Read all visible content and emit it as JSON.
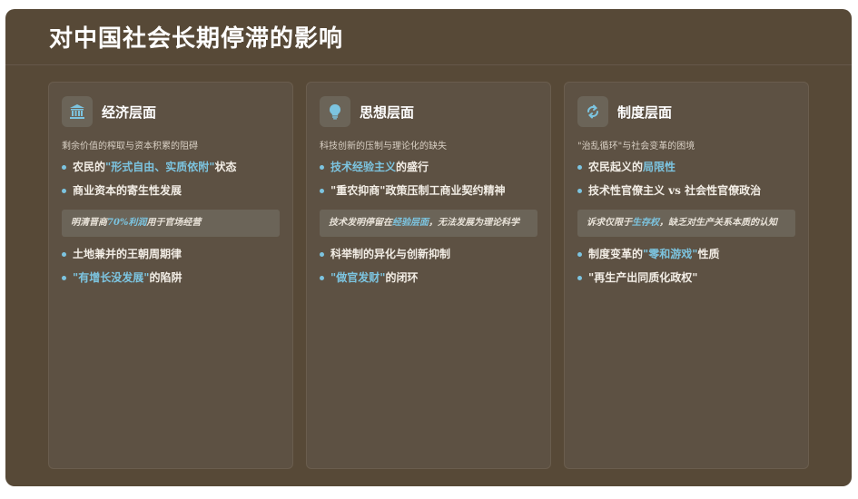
{
  "title": "对中国社会长期停滞的影响",
  "cards": [
    {
      "icon": "bank-icon",
      "title": "经济层面",
      "subtitle": "剩余价值的榨取与资本积累的阻碍",
      "b1": {
        "pre": "农民的",
        "hl": "\"形式自由、实质依附\"",
        "post": "状态"
      },
      "b2": {
        "pre": "商业资本的寄生性发展",
        "hl": "",
        "post": ""
      },
      "callout": {
        "pre": "明清晋商",
        "hl": "70%利润",
        "post": "用于官场经营"
      },
      "b3": {
        "pre": "土地兼并的王朝周期律",
        "hl": "",
        "post": ""
      },
      "b4": {
        "pre": "",
        "hl": "\"有增长没发展\"",
        "post": "的陷阱"
      }
    },
    {
      "icon": "lightbulb-icon",
      "title": "思想层面",
      "subtitle": "科技创新的压制与理论化的缺失",
      "b1": {
        "pre": "",
        "hl": "技术经验主义",
        "post": "的盛行"
      },
      "b2": {
        "pre": "\"重农抑商\"政策压制工商业契约精神",
        "hl": "",
        "post": ""
      },
      "callout": {
        "pre": "技术发明停留在",
        "hl": "经验层面",
        "post": "，无法发展为理论科学"
      },
      "b3": {
        "pre": "科举制的异化与创新抑制",
        "hl": "",
        "post": ""
      },
      "b4": {
        "pre": "",
        "hl": "\"做官发财\"",
        "post": "的闭环"
      }
    },
    {
      "icon": "cycle-arrows-icon",
      "title": "制度层面",
      "subtitle": "\"治乱循环\"与社会变革的困境",
      "b1": {
        "pre": "农民起义的",
        "hl": "局限性",
        "post": ""
      },
      "b2": {
        "pre": "技术性官僚主义 vs 社会性官僚政治",
        "hl": "",
        "post": ""
      },
      "callout": {
        "pre": "诉求仅限于",
        "hl": "生存权",
        "post": "，缺乏对生产关系本质的认知"
      },
      "b3": {
        "pre": "制度变革的",
        "hl": "\"零和游戏\"",
        "post": "性质"
      },
      "b4": {
        "pre": "\"再生产出同质化政权\"",
        "hl": "",
        "post": ""
      }
    }
  ],
  "colors": {
    "background": "#574937",
    "card": "#5d5143",
    "accent": "#7cc4e0",
    "title": "#ffffff"
  }
}
